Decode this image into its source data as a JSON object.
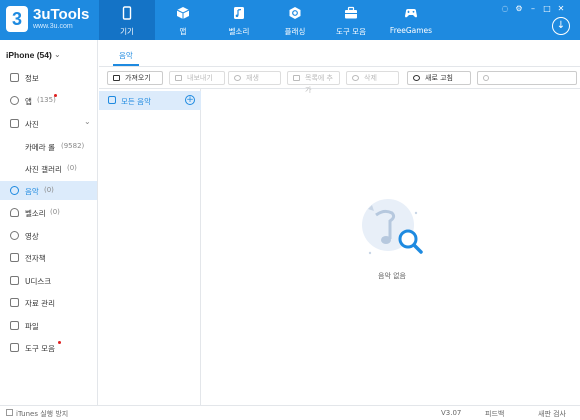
{
  "app": {
    "logo_char": "3",
    "brand": "3uTools",
    "brand_sub": "www.3u.com"
  },
  "nav": {
    "tabs": [
      {
        "label": "기기",
        "icon": "phone-icon",
        "active": true
      },
      {
        "label": "앱",
        "icon": "cube-icon",
        "active": false
      },
      {
        "label": "벨소리",
        "icon": "bell-icon",
        "active": false
      },
      {
        "label": "플래싱",
        "icon": "flash-box-icon",
        "active": false
      },
      {
        "label": "도구 모음",
        "icon": "toolbox-icon",
        "active": false
      },
      {
        "label": "FreeGames",
        "icon": "gamepad-icon",
        "active": false
      }
    ]
  },
  "device": {
    "name": "iPhone (54)"
  },
  "sidebar": {
    "items": [
      {
        "label": "정보",
        "count": "",
        "dot": false
      },
      {
        "label": "앱",
        "count": "(135)",
        "dot": true
      },
      {
        "label": "사진",
        "count": "",
        "dot": false,
        "expandable": true
      },
      {
        "label": "카메라 롤",
        "count": "(9582)",
        "dot": false,
        "sub": true
      },
      {
        "label": "사진 갤러리",
        "count": "(0)",
        "dot": false,
        "sub": true
      },
      {
        "label": "음악",
        "count": "(0)",
        "dot": false,
        "active": true
      },
      {
        "label": "벨소리",
        "count": "(0)",
        "dot": false
      },
      {
        "label": "영상",
        "count": "",
        "dot": false
      },
      {
        "label": "전자책",
        "count": "",
        "dot": false
      },
      {
        "label": "U디스크",
        "count": "",
        "dot": false
      },
      {
        "label": "자료 관리",
        "count": "",
        "dot": false
      },
      {
        "label": "파일",
        "count": "",
        "dot": false
      },
      {
        "label": "도구 모음",
        "count": "",
        "dot": true
      }
    ]
  },
  "content": {
    "tab": "음악",
    "toolbar": {
      "import": "가져오기",
      "export": "내보내기",
      "play": "재생",
      "add_to_list": "목록에 추가",
      "delete": "삭제",
      "refresh": "새로 고침",
      "search_placeholder": ""
    },
    "list": {
      "all_music": "모든 음악"
    },
    "empty_text": "음악 없음"
  },
  "statusbar": {
    "itunes": "iTunes 실행 방지",
    "version": "V3.07",
    "feedback": "피드백",
    "check_update": "새판 검사"
  },
  "colors": {
    "accent": "#1e8ae0",
    "active_bg": "#dcebfb",
    "dot": "#e02020"
  }
}
